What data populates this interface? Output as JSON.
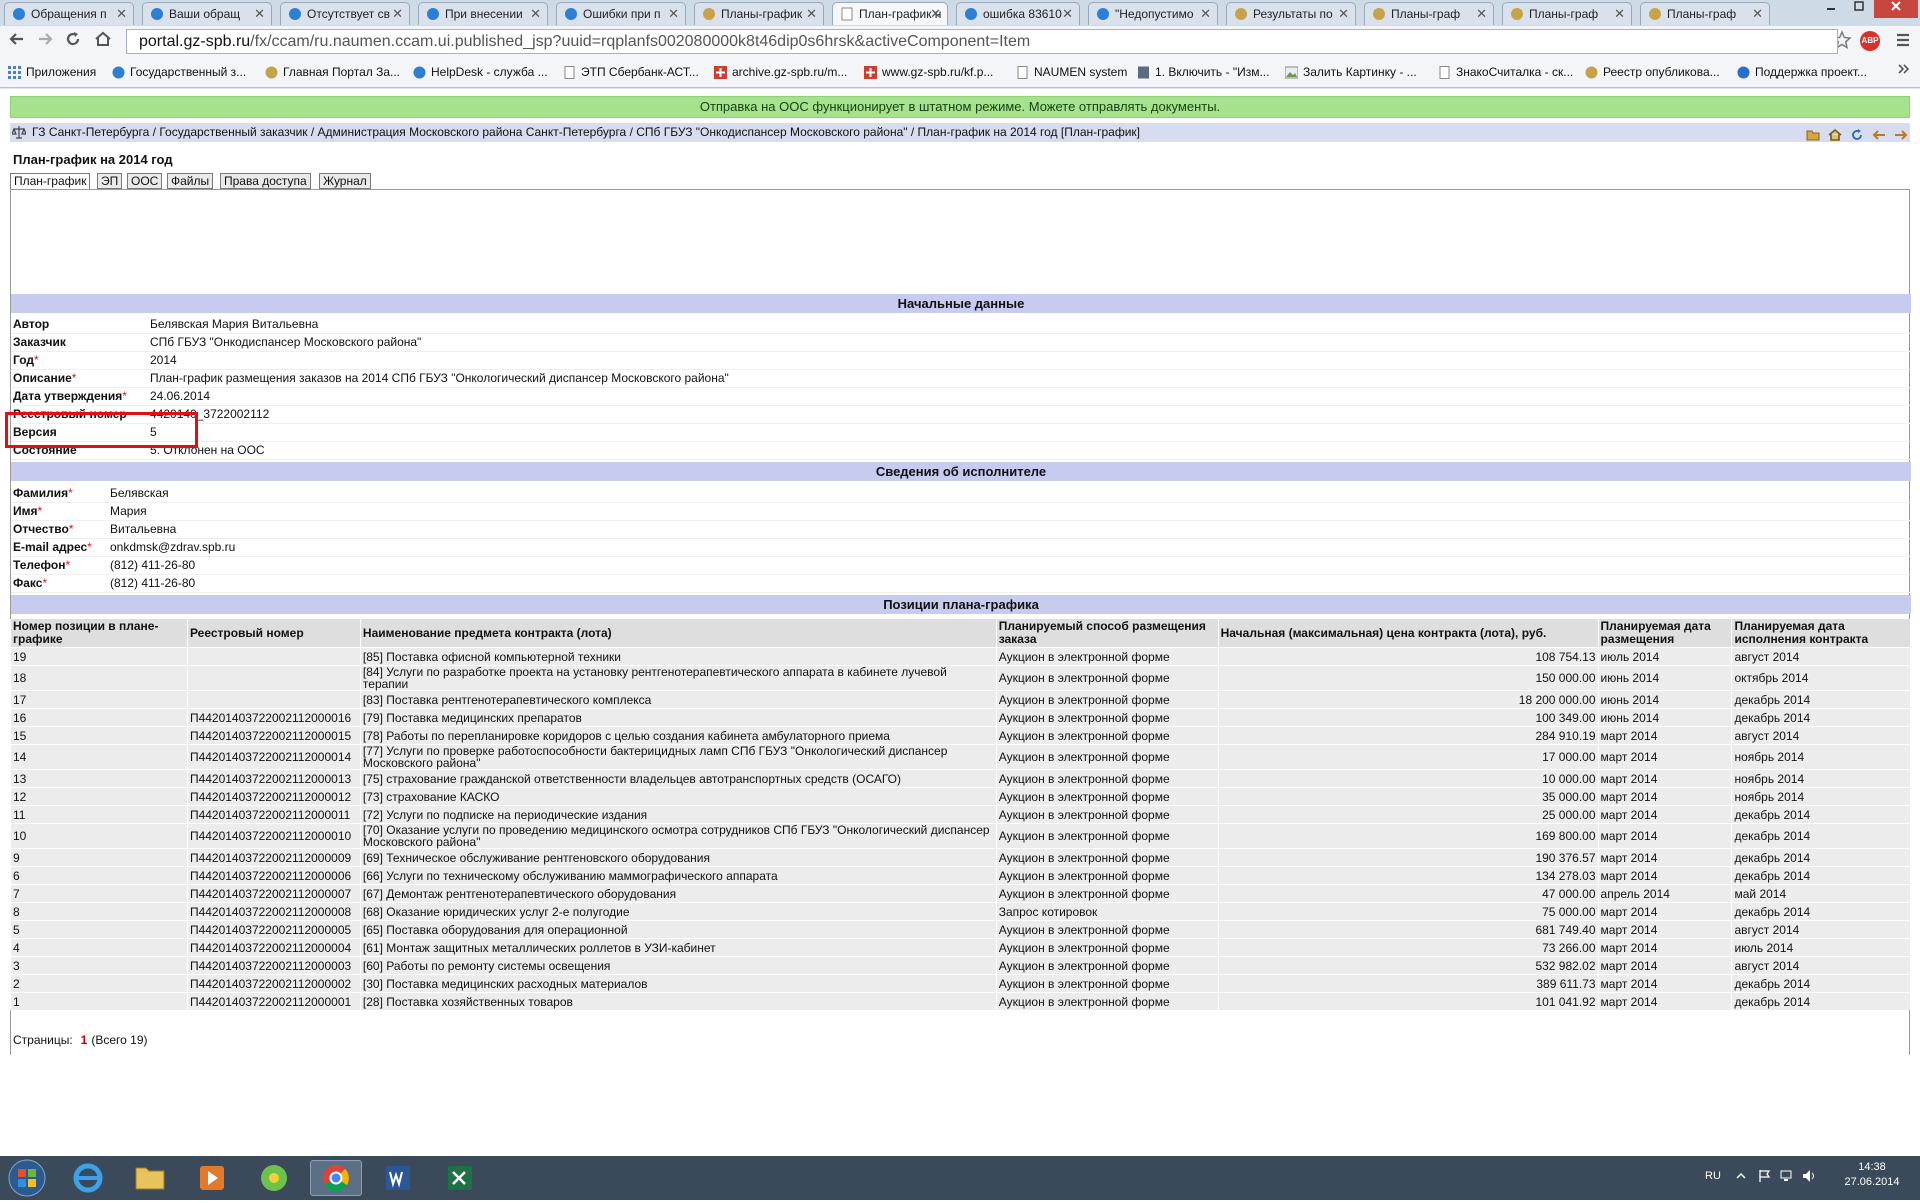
{
  "browser": {
    "tabs": [
      {
        "title": "Обращения п"
      },
      {
        "title": "Ваши обращ"
      },
      {
        "title": "Отсутствует св"
      },
      {
        "title": "При внесении"
      },
      {
        "title": "Ошибки при п"
      },
      {
        "title": "Планы-график"
      },
      {
        "title": "План-график н"
      },
      {
        "title": "ошибка 83610"
      },
      {
        "title": "\"Недопустимо"
      },
      {
        "title": "Результаты по"
      },
      {
        "title": "Планы-граф"
      },
      {
        "title": "Планы-граф"
      },
      {
        "title": "Планы-граф"
      }
    ],
    "close_glyph": "✕",
    "url_host": "portal.gz-spb.ru",
    "url_path": "/fx/ccam/ru.naumen.ccam.ui.published_jsp?uuid=rqplanfs002080000k8t46dip0s6hrsk&activeComponent=Item",
    "bookmarks": [
      {
        "label": "Приложения"
      },
      {
        "label": "Государственный з..."
      },
      {
        "label": "Главная Портал За..."
      },
      {
        "label": "HelpDesk - служба ..."
      },
      {
        "label": "ЭТП Сбербанк-АСТ..."
      },
      {
        "label": "archive.gz-spb.ru/m..."
      },
      {
        "label": "www.gz-spb.ru/kf.p..."
      },
      {
        "label": "NAUMEN system"
      },
      {
        "label": "1. Включить - \"Изм..."
      },
      {
        "label": "Залить Картинку - ..."
      },
      {
        "label": "ЗнакоСчиталка - ск..."
      },
      {
        "label": "Реестр опубликова..."
      },
      {
        "label": "Поддержка проект..."
      }
    ],
    "abp_label": "ABP"
  },
  "page": {
    "notice": "Отправка на ООС функционирует в штатном режиме. Можете отправлять документы.",
    "breadcrumb": "ГЗ Санкт-Петербурга / Государственный заказчик / Администрация Московского района Санкт-Петербурга / СПб ГБУЗ \"Онкодиспансер Московского района\" / План-график на 2014 год [План-график]",
    "title": "План-график на 2014 год",
    "subtabs": [
      "План-график",
      "ЭП",
      "ООС",
      "Файлы",
      "Права доступа",
      "Журнал"
    ],
    "required_mark": "*",
    "sections": {
      "initial": "Начальные данные",
      "executor": "Сведения об исполнителе",
      "positions": "Позиции плана-графика"
    },
    "initial_data": [
      {
        "label": "Автор",
        "value": "Белявская Мария Витальевна"
      },
      {
        "label": "Заказчик",
        "value": "СПб ГБУЗ \"Онкодиспансер Московского района\""
      },
      {
        "label": "Год",
        "value": "2014",
        "required": true
      },
      {
        "label": "Описание",
        "value": "План-график размещения заказов на 2014 СПб ГБУЗ \"Онкологический диспансер Московского района\"",
        "required": true
      },
      {
        "label": "Дата утверждения",
        "value": "24.06.2014",
        "required": true
      },
      {
        "label": "Реестровый номер",
        "value": "4420140_3722002112"
      },
      {
        "label": "Версия",
        "value": "5"
      },
      {
        "label": "Состояние",
        "value": "5. Отклонен на ООС"
      }
    ],
    "executor": [
      {
        "label": "Фамилия",
        "value": "Белявская"
      },
      {
        "label": "Имя",
        "value": "Мария"
      },
      {
        "label": "Отчество",
        "value": "Витальевна"
      },
      {
        "label": "E-mail адрес",
        "value": "onkdmsk@zdrav.spb.ru"
      },
      {
        "label": "Телефон",
        "value": "(812) 411-26-80"
      },
      {
        "label": "Факс",
        "value": "(812) 411-26-80"
      }
    ],
    "columns": [
      "Номер позиции в плане-графике",
      "Реестровый номер",
      "Наименование предмета контракта (лота)",
      "Планируемый способ размещения заказа",
      "Начальная (максимальная) цена контракта (лота), руб.",
      "Планируемая дата размещения",
      "Планируемая дата исполнения контракта"
    ],
    "rows": [
      {
        "num": "19",
        "reg": "",
        "name": "[85] Поставка офисной компьютерной техники",
        "method": "Аукцион в электронной форме",
        "price": "108 754.13",
        "placement": "июль 2014",
        "execution": "август 2014"
      },
      {
        "num": "18",
        "reg": "",
        "name": "[84] Услуги по разработке проекта на установку рентгенотерапевтического аппарата в кабинете лучевой терапии",
        "method": "Аукцион в электронной форме",
        "price": "150 000.00",
        "placement": "июнь 2014",
        "execution": "октябрь 2014",
        "tall": true
      },
      {
        "num": "17",
        "reg": "",
        "name": "[83] Поставка рентгенотерапевтического комплекса",
        "method": "Аукцион в электронной форме",
        "price": "18 200 000.00",
        "placement": "июнь 2014",
        "execution": "декабрь 2014"
      },
      {
        "num": "16",
        "reg": "П44201403722002112000016",
        "name": "[79] Поставка медицинских препаратов",
        "method": "Аукцион в электронной форме",
        "price": "100 349.00",
        "placement": "июнь 2014",
        "execution": "декабрь 2014"
      },
      {
        "num": "15",
        "reg": "П44201403722002112000015",
        "name": "[78] Работы по перепланировке коридоров с целью создания кабинета амбулаторного приема",
        "method": "Аукцион в электронной форме",
        "price": "284 910.19",
        "placement": "март 2014",
        "execution": "август 2014"
      },
      {
        "num": "14",
        "reg": "П44201403722002112000014",
        "name": "[77] Услуги по проверке работоспособности бактерицидных ламп СПб ГБУЗ \"Онкологический диспансер Московского района\"",
        "method": "Аукцион в электронной форме",
        "price": "17 000.00",
        "placement": "март 2014",
        "execution": "ноябрь 2014",
        "tall": true
      },
      {
        "num": "13",
        "reg": "П44201403722002112000013",
        "name": "[75] страхование гражданской ответственности владельцев автотранспортных средств (ОСАГО)",
        "method": "Аукцион в электронной форме",
        "price": "10 000.00",
        "placement": "март 2014",
        "execution": "ноябрь 2014"
      },
      {
        "num": "12",
        "reg": "П44201403722002112000012",
        "name": "[73] страхование КАСКО",
        "method": "Аукцион в электронной форме",
        "price": "35 000.00",
        "placement": "март 2014",
        "execution": "ноябрь 2014"
      },
      {
        "num": "11",
        "reg": "П44201403722002112000011",
        "name": "[72] Услуги по подписке на периодические издания",
        "method": "Аукцион в электронной форме",
        "price": "25 000.00",
        "placement": "март 2014",
        "execution": "декабрь 2014"
      },
      {
        "num": "10",
        "reg": "П44201403722002112000010",
        "name": "[70] Оказание услуги по проведению медицинского осмотра сотрудников СПб ГБУЗ \"Онкологический диспансер Московского района\"",
        "method": "Аукцион в электронной форме",
        "price": "169 800.00",
        "placement": "март 2014",
        "execution": "декабрь 2014",
        "tall": true
      },
      {
        "num": "9",
        "reg": "П44201403722002112000009",
        "name": "[69] Техническое обслуживание рентгеновского оборудования",
        "method": "Аукцион в электронной форме",
        "price": "190 376.57",
        "placement": "март 2014",
        "execution": "декабрь 2014"
      },
      {
        "num": "6",
        "reg": "П44201403722002112000006",
        "name": "[66] Услуги по техническому обслуживанию маммографического аппарата",
        "method": "Аукцион в электронной форме",
        "price": "134 278.03",
        "placement": "март 2014",
        "execution": "декабрь 2014"
      },
      {
        "num": "7",
        "reg": "П44201403722002112000007",
        "name": "[67] Демонтаж рентгенотерапевтического оборудования",
        "method": "Аукцион в электронной форме",
        "price": "47 000.00",
        "placement": "апрель 2014",
        "execution": "май 2014"
      },
      {
        "num": "8",
        "reg": "П44201403722002112000008",
        "name": "[68] Оказание юридических услуг 2-е полугодие",
        "method": "Запрос котировок",
        "price": "75 000.00",
        "placement": "март 2014",
        "execution": "декабрь 2014"
      },
      {
        "num": "5",
        "reg": "П44201403722002112000005",
        "name": "[65] Поставка оборудования для операционной",
        "method": "Аукцион в электронной форме",
        "price": "681 749.40",
        "placement": "март 2014",
        "execution": "август 2014"
      },
      {
        "num": "4",
        "reg": "П44201403722002112000004",
        "name": "[61] Монтаж защитных металлических роллетов в УЗИ-кабинет",
        "method": "Аукцион в электронной форме",
        "price": "73 266.00",
        "placement": "март 2014",
        "execution": "июль 2014"
      },
      {
        "num": "3",
        "reg": "П44201403722002112000003",
        "name": "[60] Работы по ремонту системы освещения",
        "method": "Аукцион в электронной форме",
        "price": "532 982.02",
        "placement": "март 2014",
        "execution": "август 2014"
      },
      {
        "num": "2",
        "reg": "П44201403722002112000002",
        "name": "[30] Поставка медицинских расходных материалов",
        "method": "Аукцион в электронной форме",
        "price": "389 611.73",
        "placement": "март 2014",
        "execution": "декабрь 2014"
      },
      {
        "num": "1",
        "reg": "П44201403722002112000001",
        "name": "[28] Поставка хозяйственных товаров",
        "method": "Аукцион в электронной форме",
        "price": "101 041.92",
        "placement": "март 2014",
        "execution": "декабрь 2014"
      }
    ],
    "pager": {
      "label": "Страницы:",
      "current": "1",
      "total": "(Всего 19)"
    }
  },
  "taskbar": {
    "lang": "RU",
    "time": "14:38",
    "date": "27.06.2014"
  },
  "colors": {
    "notice_bg": "#a6e28e",
    "section_bg": "#c7cbef",
    "highlight_box": "#e01010",
    "required_mark": "#dd1111"
  }
}
